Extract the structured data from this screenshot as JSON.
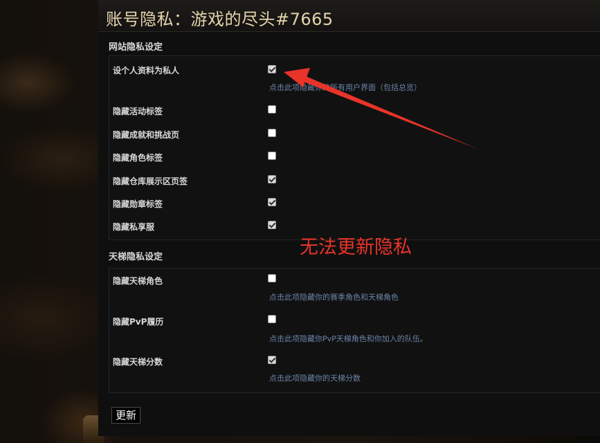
{
  "title": "账号隐私：游戏的尽头#7665",
  "website_section": {
    "heading": "网站隐私设定",
    "settings": [
      {
        "label": "设个人资料为私人",
        "checked": true,
        "hint": "点击此项隐藏你的所有用户界面（包括总览）"
      },
      {
        "label": "隐藏活动标签",
        "checked": false
      },
      {
        "label": "隐藏成就和挑战页",
        "checked": false
      },
      {
        "label": "隐藏角色标签",
        "checked": false
      },
      {
        "label": "隐藏仓库展示区页签",
        "checked": true
      },
      {
        "label": "隐藏勋章标签",
        "checked": true
      },
      {
        "label": "隐藏私享服",
        "checked": true
      }
    ]
  },
  "ladder_section": {
    "heading": "天梯隐私设定",
    "settings": [
      {
        "label": "隐藏天梯角色",
        "checked": false,
        "hint": "点击此项隐藏你的赛季角色和天梯角色"
      },
      {
        "label": "隐藏PvP履历",
        "checked": false,
        "hint": "点击此项隐藏你PvP天梯角色和你加入的队伍。"
      },
      {
        "label": "隐藏天梯分数",
        "checked": true,
        "hint": "点击此项隐藏你的天梯分数"
      }
    ]
  },
  "update_button": "更新",
  "annotation": {
    "text": "无法更新隐私",
    "color": "#e8342a"
  },
  "colors": {
    "title": "#e4d4ac",
    "hint": "#6a84a8",
    "panel": "#0f0f0f"
  }
}
